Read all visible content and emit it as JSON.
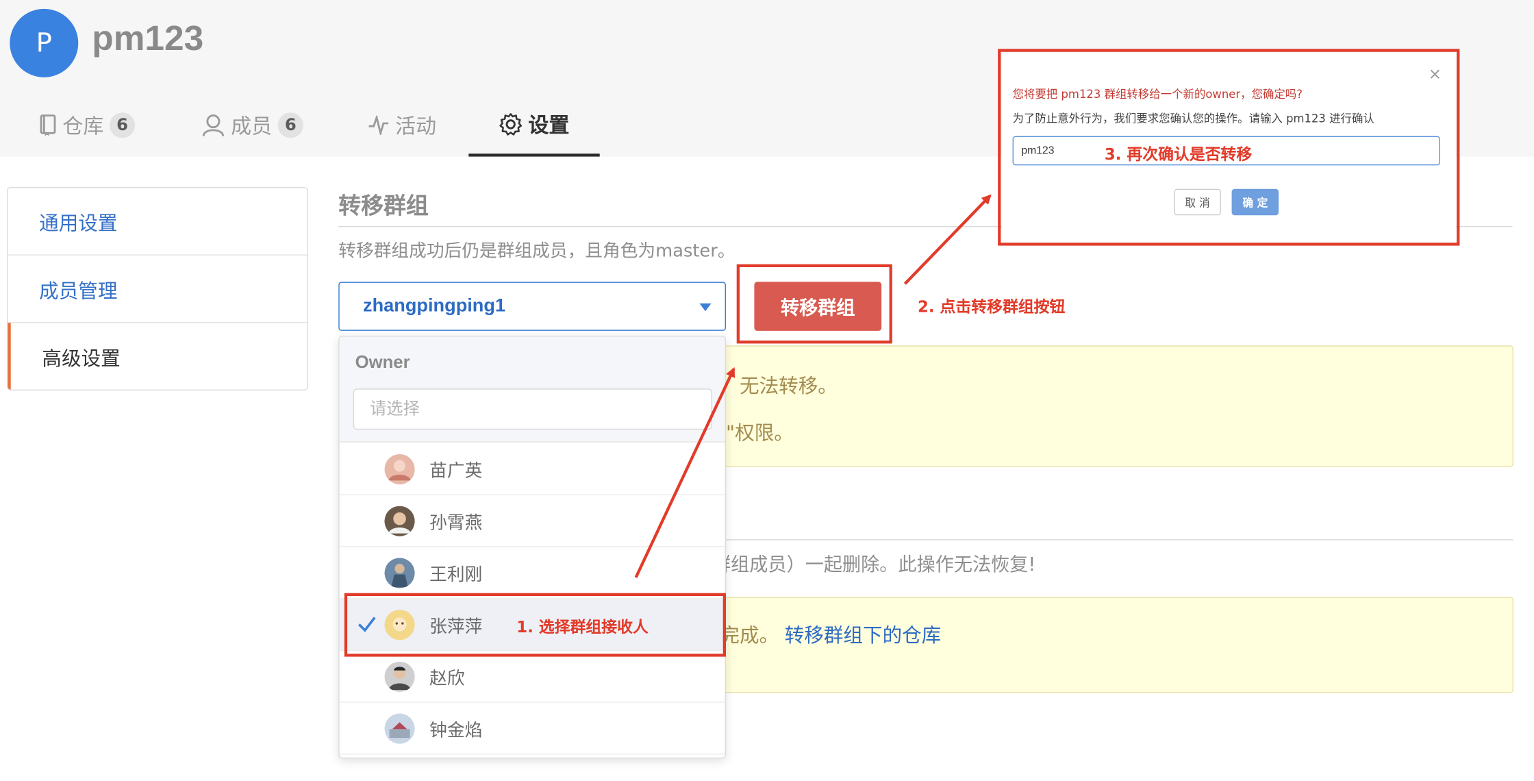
{
  "header": {
    "avatar_letter": "P",
    "group_name": "pm123",
    "tabs": [
      {
        "label": "仓库",
        "count": "6",
        "icon": "repo-book-icon"
      },
      {
        "label": "成员",
        "count": "6",
        "icon": "person-icon"
      },
      {
        "label": "活动",
        "icon": "activity-pulse-icon"
      },
      {
        "label": "设置",
        "icon": "gear-icon",
        "active": true
      }
    ]
  },
  "sidebar": {
    "items": [
      {
        "label": "通用设置"
      },
      {
        "label": "成员管理"
      },
      {
        "label": "高级设置",
        "active": true
      }
    ]
  },
  "transfer": {
    "title": "转移群组",
    "description": "转移群组成功后仍是群组成员，且角色为master。",
    "selected_value": "zhangpingping1",
    "button_label": "转移群组"
  },
  "warnings": {
    "line1_visible": "无法转移。",
    "line2_visible": "\"权限。",
    "delete_desc_visible": "群组成员）一起删除。此操作无法恢复!",
    "line3_visible": "完成。",
    "link_label": "转移群组下的仓库"
  },
  "dropdown": {
    "group_label": "Owner",
    "search_placeholder": "请选择",
    "options": [
      {
        "name": "苗广英",
        "selected": false
      },
      {
        "name": "孙霄燕",
        "selected": false
      },
      {
        "name": "王利刚",
        "selected": false
      },
      {
        "name": "张萍萍",
        "selected": true
      },
      {
        "name": "赵欣",
        "selected": false
      },
      {
        "name": "钟金焰",
        "selected": false
      }
    ]
  },
  "modal": {
    "title": "您将要把 pm123 群组转移给一个新的owner，您确定吗?",
    "description": "为了防止意外行为，我们要求您确认您的操作。请输入 pm123 进行确认",
    "input_value": "pm123",
    "cancel_label": "取 消",
    "ok_label": "确 定",
    "close_symbol": "×"
  },
  "annotations": {
    "step1": "1. 选择群组接收人",
    "step2": "2. 点击转移群组按钮",
    "step3": "3. 再次确认是否转移",
    "color": "#e23b2a"
  },
  "colors": {
    "accent_blue": "#3a82e0",
    "danger_button": "#d95a50",
    "warning_bg": "#fffedd",
    "primary_ok": "#6f9fde"
  }
}
